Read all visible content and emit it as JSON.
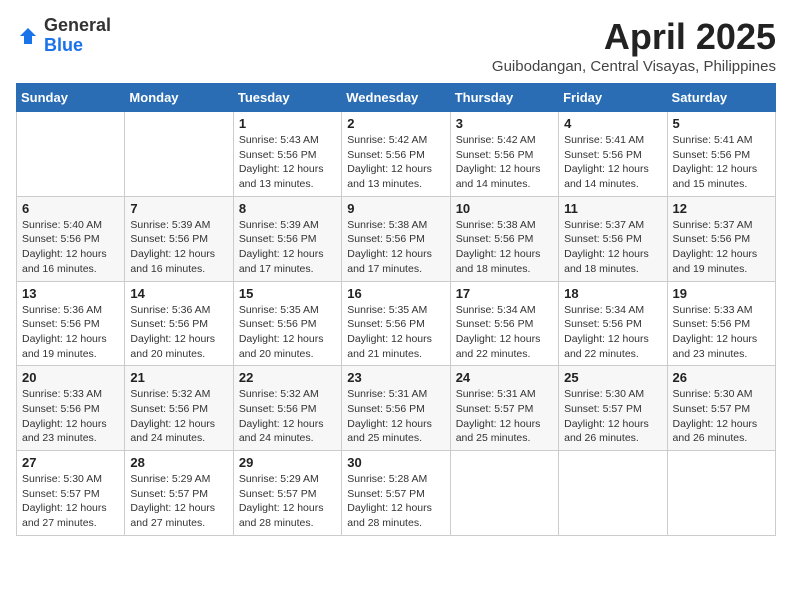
{
  "header": {
    "logo_line1": "General",
    "logo_line2": "Blue",
    "month": "April 2025",
    "location": "Guibodangan, Central Visayas, Philippines"
  },
  "weekdays": [
    "Sunday",
    "Monday",
    "Tuesday",
    "Wednesday",
    "Thursday",
    "Friday",
    "Saturday"
  ],
  "weeks": [
    [
      {
        "day": null,
        "info": null
      },
      {
        "day": null,
        "info": null
      },
      {
        "day": "1",
        "info": "Sunrise: 5:43 AM\nSunset: 5:56 PM\nDaylight: 12 hours\nand 13 minutes."
      },
      {
        "day": "2",
        "info": "Sunrise: 5:42 AM\nSunset: 5:56 PM\nDaylight: 12 hours\nand 13 minutes."
      },
      {
        "day": "3",
        "info": "Sunrise: 5:42 AM\nSunset: 5:56 PM\nDaylight: 12 hours\nand 14 minutes."
      },
      {
        "day": "4",
        "info": "Sunrise: 5:41 AM\nSunset: 5:56 PM\nDaylight: 12 hours\nand 14 minutes."
      },
      {
        "day": "5",
        "info": "Sunrise: 5:41 AM\nSunset: 5:56 PM\nDaylight: 12 hours\nand 15 minutes."
      }
    ],
    [
      {
        "day": "6",
        "info": "Sunrise: 5:40 AM\nSunset: 5:56 PM\nDaylight: 12 hours\nand 16 minutes."
      },
      {
        "day": "7",
        "info": "Sunrise: 5:39 AM\nSunset: 5:56 PM\nDaylight: 12 hours\nand 16 minutes."
      },
      {
        "day": "8",
        "info": "Sunrise: 5:39 AM\nSunset: 5:56 PM\nDaylight: 12 hours\nand 17 minutes."
      },
      {
        "day": "9",
        "info": "Sunrise: 5:38 AM\nSunset: 5:56 PM\nDaylight: 12 hours\nand 17 minutes."
      },
      {
        "day": "10",
        "info": "Sunrise: 5:38 AM\nSunset: 5:56 PM\nDaylight: 12 hours\nand 18 minutes."
      },
      {
        "day": "11",
        "info": "Sunrise: 5:37 AM\nSunset: 5:56 PM\nDaylight: 12 hours\nand 18 minutes."
      },
      {
        "day": "12",
        "info": "Sunrise: 5:37 AM\nSunset: 5:56 PM\nDaylight: 12 hours\nand 19 minutes."
      }
    ],
    [
      {
        "day": "13",
        "info": "Sunrise: 5:36 AM\nSunset: 5:56 PM\nDaylight: 12 hours\nand 19 minutes."
      },
      {
        "day": "14",
        "info": "Sunrise: 5:36 AM\nSunset: 5:56 PM\nDaylight: 12 hours\nand 20 minutes."
      },
      {
        "day": "15",
        "info": "Sunrise: 5:35 AM\nSunset: 5:56 PM\nDaylight: 12 hours\nand 20 minutes."
      },
      {
        "day": "16",
        "info": "Sunrise: 5:35 AM\nSunset: 5:56 PM\nDaylight: 12 hours\nand 21 minutes."
      },
      {
        "day": "17",
        "info": "Sunrise: 5:34 AM\nSunset: 5:56 PM\nDaylight: 12 hours\nand 22 minutes."
      },
      {
        "day": "18",
        "info": "Sunrise: 5:34 AM\nSunset: 5:56 PM\nDaylight: 12 hours\nand 22 minutes."
      },
      {
        "day": "19",
        "info": "Sunrise: 5:33 AM\nSunset: 5:56 PM\nDaylight: 12 hours\nand 23 minutes."
      }
    ],
    [
      {
        "day": "20",
        "info": "Sunrise: 5:33 AM\nSunset: 5:56 PM\nDaylight: 12 hours\nand 23 minutes."
      },
      {
        "day": "21",
        "info": "Sunrise: 5:32 AM\nSunset: 5:56 PM\nDaylight: 12 hours\nand 24 minutes."
      },
      {
        "day": "22",
        "info": "Sunrise: 5:32 AM\nSunset: 5:56 PM\nDaylight: 12 hours\nand 24 minutes."
      },
      {
        "day": "23",
        "info": "Sunrise: 5:31 AM\nSunset: 5:56 PM\nDaylight: 12 hours\nand 25 minutes."
      },
      {
        "day": "24",
        "info": "Sunrise: 5:31 AM\nSunset: 5:57 PM\nDaylight: 12 hours\nand 25 minutes."
      },
      {
        "day": "25",
        "info": "Sunrise: 5:30 AM\nSunset: 5:57 PM\nDaylight: 12 hours\nand 26 minutes."
      },
      {
        "day": "26",
        "info": "Sunrise: 5:30 AM\nSunset: 5:57 PM\nDaylight: 12 hours\nand 26 minutes."
      }
    ],
    [
      {
        "day": "27",
        "info": "Sunrise: 5:30 AM\nSunset: 5:57 PM\nDaylight: 12 hours\nand 27 minutes."
      },
      {
        "day": "28",
        "info": "Sunrise: 5:29 AM\nSunset: 5:57 PM\nDaylight: 12 hours\nand 27 minutes."
      },
      {
        "day": "29",
        "info": "Sunrise: 5:29 AM\nSunset: 5:57 PM\nDaylight: 12 hours\nand 28 minutes."
      },
      {
        "day": "30",
        "info": "Sunrise: 5:28 AM\nSunset: 5:57 PM\nDaylight: 12 hours\nand 28 minutes."
      },
      {
        "day": null,
        "info": null
      },
      {
        "day": null,
        "info": null
      },
      {
        "day": null,
        "info": null
      }
    ]
  ]
}
